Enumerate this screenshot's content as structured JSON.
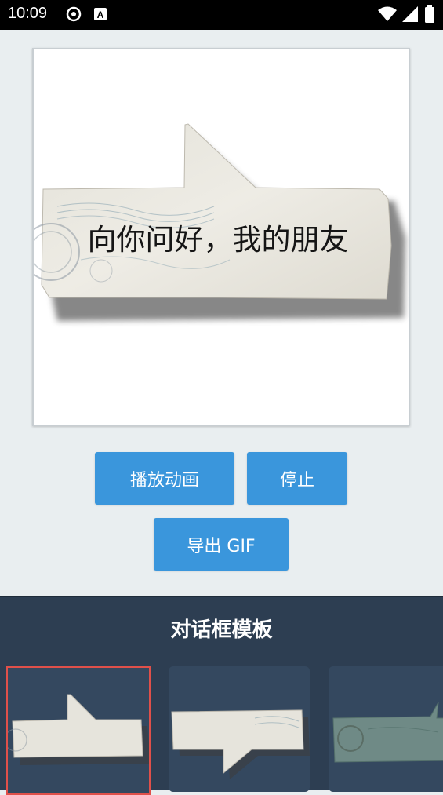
{
  "status_bar": {
    "time": "10:09",
    "icons": [
      "signal-app-icon",
      "a-app-icon",
      "wifi-icon",
      "cell-signal-icon",
      "battery-icon"
    ]
  },
  "preview": {
    "caption": "向你问好，我的朋友"
  },
  "buttons": {
    "play": "播放动画",
    "stop": "停止",
    "export": "导出 GIF"
  },
  "templates_panel": {
    "title": "对话框模板",
    "selected_index": 0
  },
  "colors": {
    "accent": "#3a96dc",
    "panel_bg": "#2d3e52",
    "selection": "#e0504a"
  }
}
